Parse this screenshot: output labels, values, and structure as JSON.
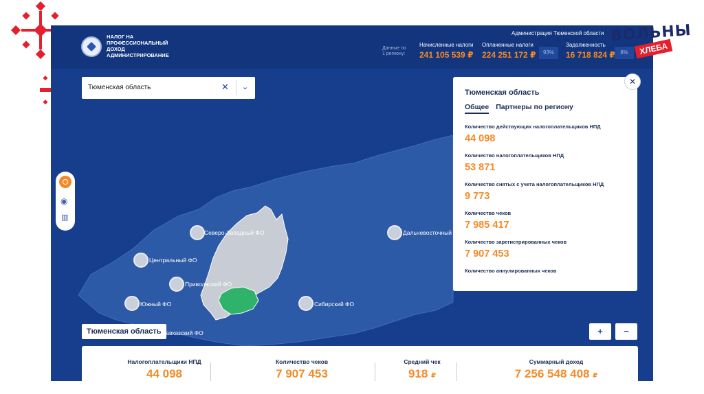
{
  "brand": {
    "top_text": "ВОЛЬНЫ",
    "bottom_text": "ХЛЕБА"
  },
  "header": {
    "logo_text": "НАЛОГ НА ПРОФЕССИОНАЛЬНЫЙ ДОХОД АДМИНИСТРИРОВАНИЕ",
    "admin_title": "Администрация Тюменской области",
    "stats_note": "Данные по 1 региону:",
    "stats": [
      {
        "label": "Начисленные налоги",
        "value": "241 105 539 ₽"
      },
      {
        "label": "Оплаченные налоги",
        "value": "224 251 172 ₽",
        "percent": "93%"
      },
      {
        "label": "Задолженность",
        "value": "16 718 824 ₽",
        "percent": "8%"
      }
    ]
  },
  "map": {
    "region_select": {
      "value": "Тюменская область",
      "clear_icon": "close-icon",
      "toggle_icon": "chevron-down-icon"
    },
    "districts": [
      {
        "label": "Северо-Западный ФО"
      },
      {
        "label": "Центральный ФО"
      },
      {
        "label": "Приволжский ФО"
      },
      {
        "label": "Южный ФО"
      },
      {
        "label": "Сибирский ФО"
      },
      {
        "label": "Дальневосточный ФО"
      },
      {
        "label": "Северо-Кавказский ФО"
      }
    ],
    "region_tag": "Тюменская область",
    "zoom_in": "+",
    "zoom_out": "−",
    "colors": {
      "map_bg": "#173e8c",
      "land": "#2c5aa6",
      "highlight_ufo": "#c8ccd4",
      "selected_region": "#2fb36b"
    }
  },
  "panel": {
    "title": "Тюменская область",
    "tabs": [
      "Общее",
      "Партнеры по региону"
    ],
    "active_tab": "Общее",
    "metrics": [
      {
        "label": "Количество действующих налогоплательщиков НПД",
        "value": "44 098"
      },
      {
        "label": "Количество налогоплательщиков НПД",
        "value": "53 871"
      },
      {
        "label": "Количество снятых с учета налогоплательщиков НПД",
        "value": "9 773"
      },
      {
        "label": "Количество чеков",
        "value": "7 985 417"
      },
      {
        "label": "Количество зарегистрированных чеков",
        "value": "7 907 453"
      },
      {
        "label": "Количество аннулированных чеков",
        "value": ""
      }
    ],
    "close_icon": "close-icon"
  },
  "summary": {
    "items": [
      {
        "label": "Налогоплательщики НПД",
        "value": "44 098",
        "unit": ""
      },
      {
        "label": "Количество чеков",
        "value": "7 907 453",
        "unit": ""
      },
      {
        "label": "Средний чек",
        "value": "918",
        "unit": "₽"
      },
      {
        "label": "Суммарный доход",
        "value": "7 256 548 408",
        "unit": "₽"
      }
    ]
  }
}
